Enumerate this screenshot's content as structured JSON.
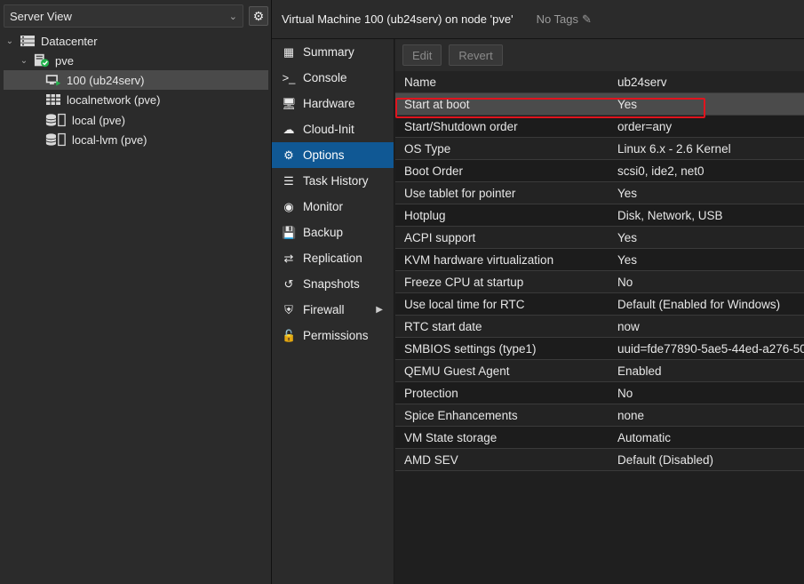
{
  "left_panel": {
    "view_select": "Server View",
    "tree": [
      {
        "label": "Datacenter",
        "icon": "datacenter-icon"
      },
      {
        "label": "pve",
        "icon": "node-online-icon"
      },
      {
        "label": "100 (ub24serv)",
        "icon": "vm-running-icon"
      },
      {
        "label": "localnetwork (pve)",
        "icon": "network-grid-icon"
      },
      {
        "label": "local (pve)",
        "icon": "storage-icon"
      },
      {
        "label": "local-lvm (pve)",
        "icon": "storage-icon"
      }
    ]
  },
  "header": {
    "title": "Virtual Machine 100 (ub24serv) on node 'pve'",
    "tags": "No Tags"
  },
  "nav": [
    {
      "label": "Summary",
      "icon": "summary-icon"
    },
    {
      "label": "Console",
      "icon": "console-icon"
    },
    {
      "label": "Hardware",
      "icon": "monitor-icon"
    },
    {
      "label": "Cloud-Init",
      "icon": "cloud-icon"
    },
    {
      "label": "Options",
      "icon": "gear-icon"
    },
    {
      "label": "Task History",
      "icon": "list-icon"
    },
    {
      "label": "Monitor",
      "icon": "eye-icon"
    },
    {
      "label": "Backup",
      "icon": "floppy-icon"
    },
    {
      "label": "Replication",
      "icon": "retweet-icon"
    },
    {
      "label": "Snapshots",
      "icon": "history-icon"
    },
    {
      "label": "Firewall",
      "icon": "shield-icon"
    },
    {
      "label": "Permissions",
      "icon": "unlock-icon"
    }
  ],
  "toolbar": {
    "edit": "Edit",
    "revert": "Revert"
  },
  "options": [
    {
      "key": "Name",
      "value": "ub24serv"
    },
    {
      "key": "Start at boot",
      "value": "Yes"
    },
    {
      "key": "Start/Shutdown order",
      "value": "order=any"
    },
    {
      "key": "OS Type",
      "value": "Linux 6.x - 2.6 Kernel"
    },
    {
      "key": "Boot Order",
      "value": "scsi0, ide2, net0"
    },
    {
      "key": "Use tablet for pointer",
      "value": "Yes"
    },
    {
      "key": "Hotplug",
      "value": "Disk, Network, USB"
    },
    {
      "key": "ACPI support",
      "value": "Yes"
    },
    {
      "key": "KVM hardware virtualization",
      "value": "Yes"
    },
    {
      "key": "Freeze CPU at startup",
      "value": "No"
    },
    {
      "key": "Use local time for RTC",
      "value": "Default (Enabled for Windows)"
    },
    {
      "key": "RTC start date",
      "value": "now"
    },
    {
      "key": "SMBIOS settings (type1)",
      "value": "uuid=fde77890-5ae5-44ed-a276-50"
    },
    {
      "key": "QEMU Guest Agent",
      "value": "Enabled"
    },
    {
      "key": "Protection",
      "value": "No"
    },
    {
      "key": "Spice Enhancements",
      "value": "none"
    },
    {
      "key": "VM State storage",
      "value": "Automatic"
    },
    {
      "key": "AMD SEV",
      "value": "Default (Disabled)"
    }
  ]
}
